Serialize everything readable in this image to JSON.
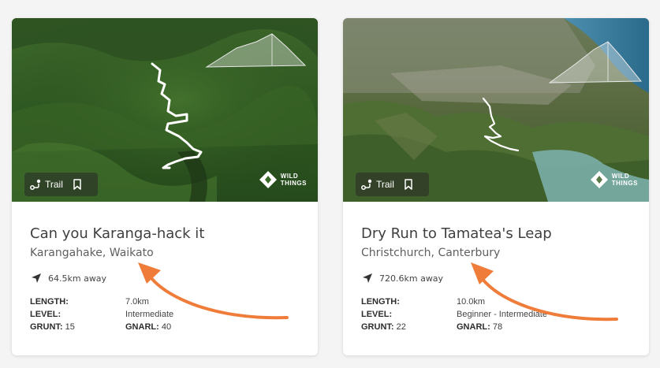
{
  "colors": {
    "accent": "#f07c3a",
    "card_bg": "#ffffff",
    "page_bg": "#f4f4f4",
    "text": "#3f3f3f"
  },
  "cards": [
    {
      "badge_label": "Trail",
      "brand_line1": "WILD",
      "brand_line2": "THINGS",
      "title": "Can you Karanga-hack it",
      "location": "Karangahake, Waikato",
      "distance": "64.5km away",
      "length_label": "LENGTH:",
      "length_value": "7.0km",
      "level_label": "LEVEL:",
      "level_value": "Intermediate",
      "grunt_label": "GRUNT:",
      "grunt_value": "15",
      "gnarl_label": "GNARL:",
      "gnarl_value": "40"
    },
    {
      "badge_label": "Trail",
      "brand_line1": "WILD",
      "brand_line2": "THINGS",
      "title": "Dry Run to Tamatea's Leap",
      "location": "Christchurch, Canterbury",
      "distance": "720.6km away",
      "length_label": "LENGTH:",
      "length_value": "10.0km",
      "level_label": "LEVEL:",
      "level_value": "Beginner - Intermediate",
      "grunt_label": "GRUNT:",
      "grunt_value": "22",
      "gnarl_label": "GNARL:",
      "gnarl_value": "78"
    }
  ]
}
